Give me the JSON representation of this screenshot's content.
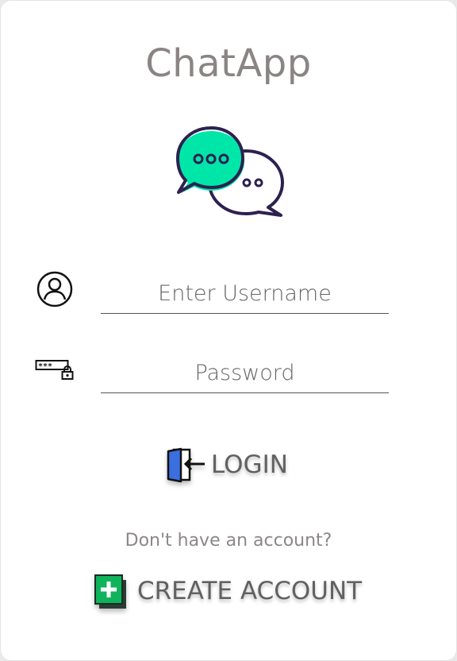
{
  "app": {
    "title": "ChatApp",
    "logo_icon": "chat-bubbles-icon"
  },
  "form": {
    "username": {
      "icon": "user-icon",
      "placeholder": "Enter Username",
      "value": ""
    },
    "password": {
      "icon": "password-lock-icon",
      "placeholder": "Password",
      "value": ""
    }
  },
  "login_button": {
    "icon": "door-login-icon",
    "label": "LOGIN"
  },
  "signup_prompt": "Don't have an account?",
  "create_account_button": {
    "icon": "add-square-icon",
    "label": "CREATE ACCOUNT"
  },
  "colors": {
    "accent_green": "#00e6a8",
    "outline_purple": "#2d2150",
    "door_blue": "#3b6fe0",
    "add_green": "#0fb35b"
  }
}
